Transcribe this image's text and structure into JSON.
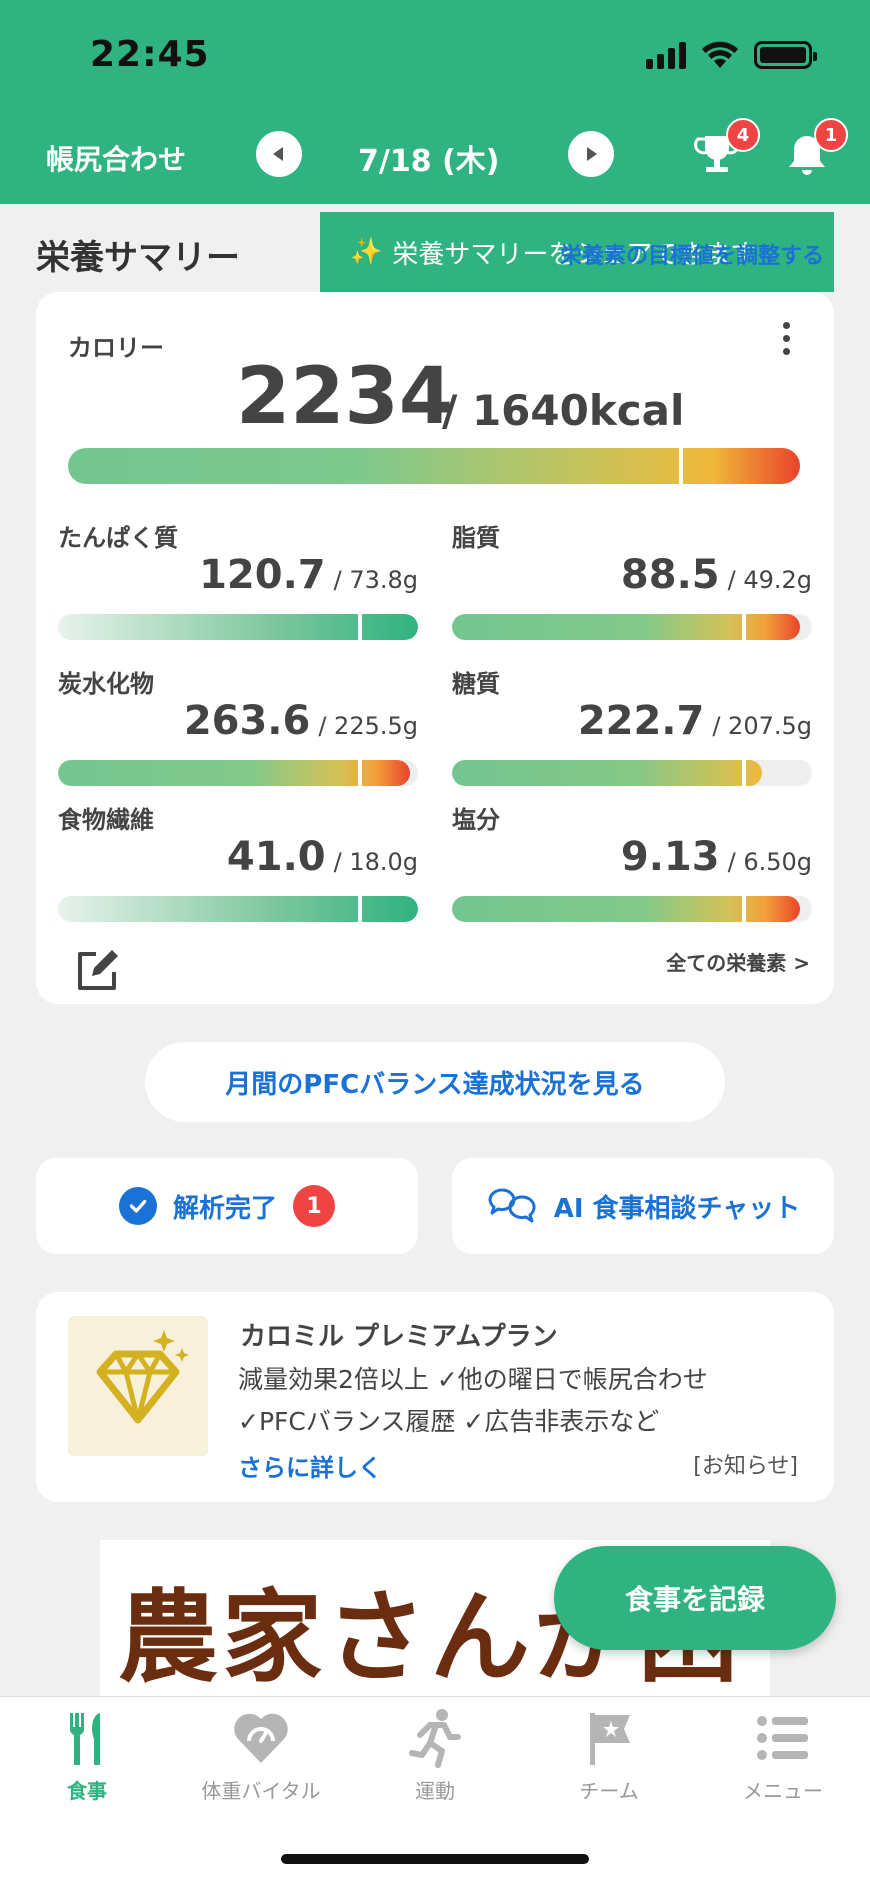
{
  "status_bar": {
    "time": "22:45"
  },
  "header": {
    "title": "帳尻合わせ",
    "date": "7/18 (木)",
    "trophy_badge": "4",
    "bell_badge": "1"
  },
  "summary": {
    "section_title": "栄養サマリー",
    "tooltip_text": "栄養サマリーをシェアできます",
    "tooltip_link": "栄養素の目標値を調整する",
    "calorie": {
      "label": "カロリー",
      "value": "2234",
      "target": "/ 1640kcal",
      "progress": 1.36
    },
    "nutrients": [
      {
        "label": "たんぱく質",
        "value": "120.7",
        "target": "/ 73.8g",
        "progress": 1.64
      },
      {
        "label": "脂質",
        "value": "88.5",
        "target": "/ 49.2g",
        "progress": 1.8
      },
      {
        "label": "炭水化物",
        "value": "263.6",
        "target": "/ 225.5g",
        "progress": 1.17
      },
      {
        "label": "糖質",
        "value": "222.7",
        "target": "/ 207.5g",
        "progress": 1.07
      },
      {
        "label": "食物繊維",
        "value": "41.0",
        "target": "/ 18.0g",
        "progress": 2.28
      },
      {
        "label": "塩分",
        "value": "9.13",
        "target": "/ 6.50g",
        "progress": 1.4
      }
    ],
    "all_nutrients_link": "全ての栄養素 >"
  },
  "pfc_button": "月間のPFCバランス達成状況を見る",
  "analysis": {
    "label": "解析完了",
    "count": "1"
  },
  "chat": {
    "label": "AI 食事相談チャット"
  },
  "premium": {
    "title": "カロミル プレミアムプラン",
    "line1": "減量効果2倍以上 ✓他の曜日で帳尻合わせ",
    "line2": "✓PFCバランス履歴 ✓広告非表示など",
    "more": "さらに詳しく",
    "notice": "[お知らせ]"
  },
  "ad": {
    "text": "農家さんが困っています"
  },
  "fab": "食事を記録",
  "tabs": [
    {
      "label": "食事",
      "icon": "fork-knife-icon"
    },
    {
      "label": "体重バイタル",
      "icon": "heart-scale-icon"
    },
    {
      "label": "運動",
      "icon": "running-icon"
    },
    {
      "label": "チーム",
      "icon": "flag-icon"
    },
    {
      "label": "メニュー",
      "icon": "menu-list-icon"
    }
  ],
  "colors": {
    "brand_green": "#2fb380",
    "link_blue": "#1a72d6",
    "badge_red": "#ef4444"
  }
}
